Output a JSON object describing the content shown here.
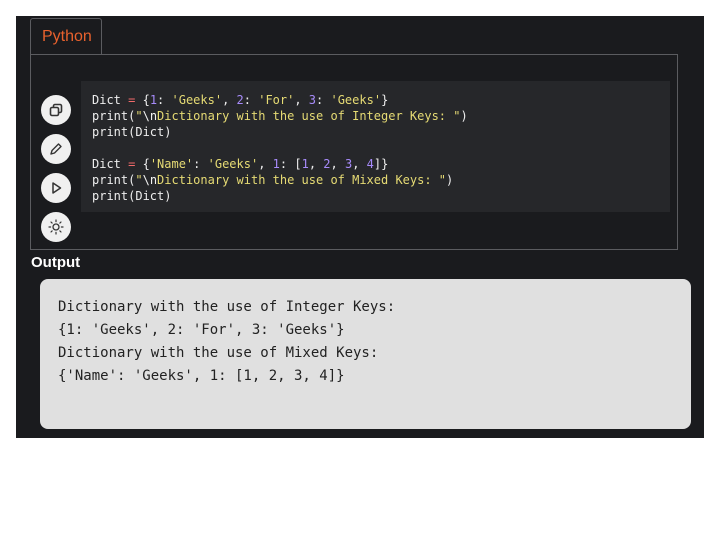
{
  "tab": {
    "label": "Python"
  },
  "toolbar": {
    "buttons": [
      {
        "icon": "copy-icon"
      },
      {
        "icon": "edit-icon"
      },
      {
        "icon": "run-icon"
      },
      {
        "icon": "theme-icon"
      }
    ]
  },
  "code": {
    "line1": {
      "a": "Dict ",
      "b": "=",
      "c": " {",
      "d": "1",
      "e": ": ",
      "f": "'Geeks'",
      "g": ", ",
      "h": "2",
      "i": ": ",
      "j": "'For'",
      "k": ", ",
      "l": "3",
      "m": ": ",
      "n": "'Geeks'",
      "o": "}"
    },
    "line2": {
      "a": "print(",
      "b": "\"",
      "c": "\\n",
      "d": "Dictionary with the use of Integer Keys: \"",
      "e": ")"
    },
    "line3": {
      "a": "print(Dict)"
    },
    "line5": {
      "a": "Dict ",
      "b": "=",
      "c": " {",
      "d": "'Name'",
      "e": ": ",
      "f": "'Geeks'",
      "g": ", ",
      "h": "1",
      "i": ": [",
      "j": "1",
      "k": ", ",
      "l": "2",
      "m": ", ",
      "n": "3",
      "o": ", ",
      "p": "4",
      "q": "]}"
    },
    "line6": {
      "a": "print(",
      "b": "\"",
      "c": "\\n",
      "d": "Dictionary with the use of Mixed Keys: \"",
      "e": ")"
    },
    "line7": {
      "a": "print(Dict)"
    }
  },
  "output": {
    "label": "Output",
    "lines": [
      "Dictionary with the use of Integer Keys: ",
      "{1: 'Geeks', 2: 'For', 3: 'Geeks'}",
      "Dictionary with the use of Mixed Keys: ",
      "{'Name': 'Geeks', 1: [1, 2, 3, 4]}"
    ]
  },
  "colors": {
    "panel_bg": "#1a1b1e",
    "code_bg": "#26272a",
    "tab_text": "#e8612d",
    "keyword_op": "#f26a6a",
    "number": "#a78bfa",
    "string": "#e6db74",
    "output_bg": "#e0e0e0"
  }
}
